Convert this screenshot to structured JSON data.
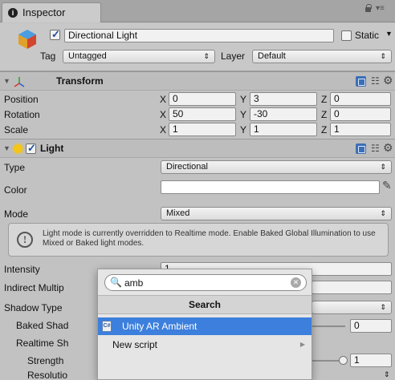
{
  "window": {
    "tab_title": "Inspector"
  },
  "gameobject": {
    "name": "Directional Light",
    "static_label": "Static",
    "tag_label": "Tag",
    "tag_value": "Untagged",
    "layer_label": "Layer",
    "layer_value": "Default"
  },
  "transform": {
    "title": "Transform",
    "rows": [
      {
        "label": "Position",
        "x": "0",
        "y": "3",
        "z": "0"
      },
      {
        "label": "Rotation",
        "x": "50",
        "y": "-30",
        "z": "0"
      },
      {
        "label": "Scale",
        "x": "1",
        "y": "1",
        "z": "1"
      }
    ],
    "axes": {
      "x": "X",
      "y": "Y",
      "z": "Z"
    }
  },
  "light": {
    "title": "Light",
    "type_label": "Type",
    "type_value": "Directional",
    "color_label": "Color",
    "color_value": "#ffffff",
    "mode_label": "Mode",
    "mode_value": "Mixed",
    "help_text": "Light mode is currently overridden to Realtime mode. Enable Baked Global Illumination to use Mixed or Baked light modes.",
    "intensity_label": "Intensity",
    "intensity_value": "1",
    "indirect_label": "Indirect Multip",
    "shadow_type_label": "Shadow Type",
    "baked_shadow_label": "Baked Shad",
    "baked_shadow_value": "0",
    "realtime_shadow_label": "Realtime Sh",
    "strength_label": "Strength",
    "strength_value": "1",
    "resolution_label": "Resolutio"
  },
  "popup": {
    "search_value": "amb",
    "title": "Search",
    "items": [
      {
        "label": "Unity AR Ambient",
        "icon": "cs-script-icon",
        "selected": true
      },
      {
        "label": "New script",
        "submenu": true
      }
    ]
  },
  "colors": {
    "selection": "#3c7fdc",
    "panel": "#c2c2c2",
    "light_icon": "#f5c518"
  }
}
